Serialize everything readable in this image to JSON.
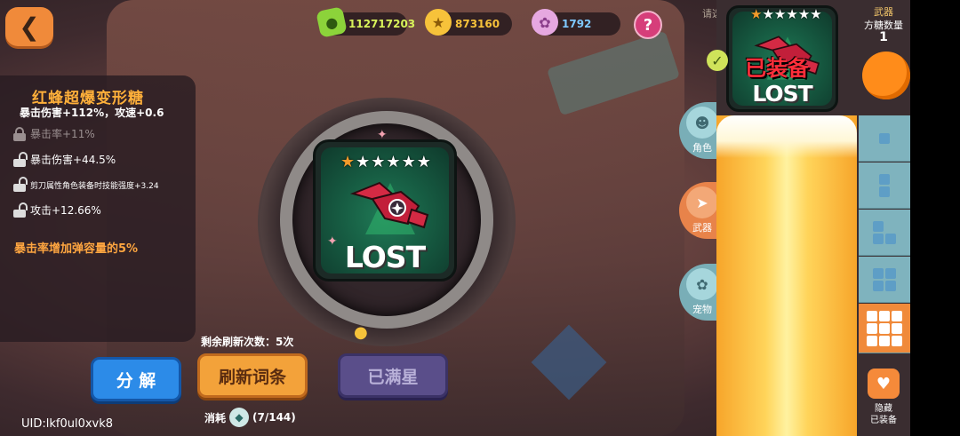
{
  "resources": {
    "candy": "112717203",
    "stars": "873160",
    "gems": "1792"
  },
  "help_label": "?",
  "select_hint": "请选择",
  "item": {
    "name": "红蜂超爆变形糖",
    "main_stat": "暴击伤害+112%，攻速+0.6",
    "sub_stats": [
      {
        "text": "暴击率+11%",
        "locked": true
      },
      {
        "text": "暴击伤害+44.5%",
        "locked": false
      },
      {
        "text": "剪刀属性角色装备时技能强度+3.24",
        "locked": false
      },
      {
        "text": "攻击+12.66%",
        "locked": false
      }
    ],
    "bonus": "暴击率增加弹容量的5%",
    "card_text": "LOST",
    "stars_total": 6,
    "stars_lit": 1
  },
  "refresh_count": "剩余刷新次数：5次",
  "buttons": {
    "decompose": "分 解",
    "refresh": "刷新词条",
    "max_star": "已满星"
  },
  "cost": {
    "label": "消耗",
    "value": "(7/144)"
  },
  "uid": "UID:lkf0ul0xvk8",
  "categories": {
    "role": "角色",
    "weapon": "武器",
    "pet": "宠物"
  },
  "equipped": {
    "badge": "已装备",
    "card_text": "LOST",
    "stars_total": 6,
    "stars_lit": 1
  },
  "slots": {
    "title": "武器",
    "subtitle": "方糖数量",
    "count": "1",
    "hide_label_1": "隐藏",
    "hide_label_2": "已装备"
  },
  "colors": {
    "accent_orange": "#f08a3a",
    "title_orange": "#ffb03a",
    "glow_yellow": "#ffd45a",
    "button_blue": "#2c8be8",
    "button_purple": "#5a4e8a"
  }
}
